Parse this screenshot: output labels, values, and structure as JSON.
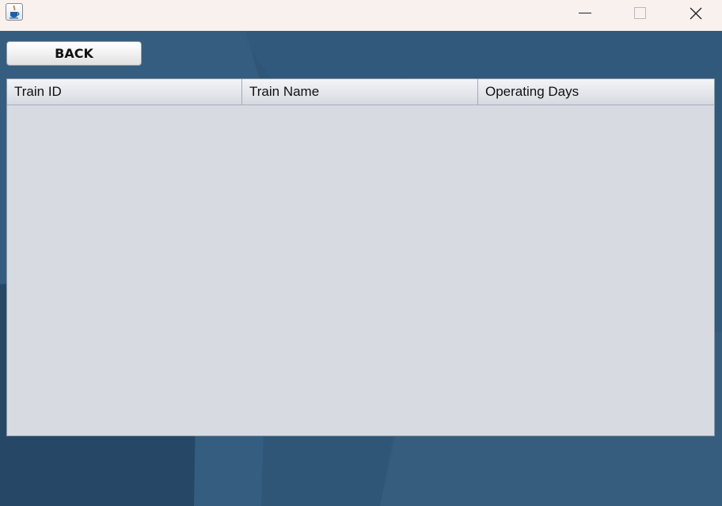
{
  "titlebar": {
    "app_icon": "java-cup-icon",
    "controls": [
      "minimize-icon",
      "maximize-icon",
      "close-icon"
    ]
  },
  "toolbar": {
    "back_label": "BACK"
  },
  "table": {
    "columns": [
      "Train ID",
      "Train Name",
      "Operating Days"
    ],
    "rows": []
  }
}
